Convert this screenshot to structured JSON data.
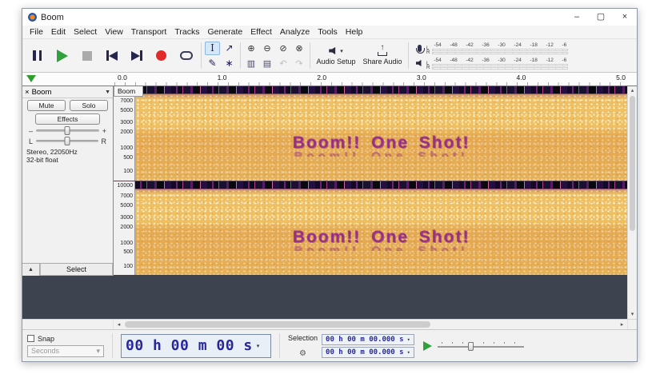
{
  "window": {
    "title": "Boom"
  },
  "window_controls": {
    "minimize": "–",
    "maximize": "▢",
    "close": "×"
  },
  "menu": {
    "items": [
      "File",
      "Edit",
      "Select",
      "View",
      "Transport",
      "Tracks",
      "Generate",
      "Effect",
      "Analyze",
      "Tools",
      "Help"
    ]
  },
  "toolbar": {
    "audio_setup_label": "Audio Setup",
    "share_audio_label": "Share Audio",
    "share_arrow": "↑",
    "dropdown_arrow": "▾",
    "meter_scale": [
      "-54",
      "-48",
      "-42",
      "-36",
      "-30",
      "-24",
      "-18",
      "-12",
      "-6"
    ],
    "meter_channels": [
      "L",
      "R"
    ],
    "tool_icons": {
      "selection": "I",
      "envelope": "↗",
      "draw": "✎",
      "multi": "∗"
    },
    "edit_icons": {
      "zoom_in": "⊕",
      "zoom_out": "⊖",
      "zoom_selection": "⊘",
      "zoom_toggle": "⊗",
      "trim": "▥",
      "silence": "▤",
      "undo": "↶",
      "redo": "↷"
    }
  },
  "timeline": {
    "ticks": [
      "0.0",
      "1.0",
      "2.0",
      "3.0",
      "4.0",
      "5.0"
    ]
  },
  "track": {
    "name": "Boom",
    "close_icon": "×",
    "menu_arrow": "▼",
    "mute_label": "Mute",
    "solo_label": "Solo",
    "effects_label": "Effects",
    "gain_minus": "–",
    "gain_plus": "+",
    "pan_left": "L",
    "pan_right": "R",
    "info_line1": "Stereo, 22050Hz",
    "info_line2": "32-bit float",
    "collapse_icon": "▲",
    "select_label": "Select",
    "freq_labels": [
      "10000",
      "7000",
      "5000",
      "3000",
      "2000",
      "1000",
      "500",
      "100"
    ],
    "spectrogram_text": "Boom!! One Shot!"
  },
  "scrollbars": {
    "up": "▴",
    "down": "▾",
    "left": "◂",
    "right": "▸"
  },
  "bottom": {
    "snap_label": "Snap",
    "snap_mode": "Seconds",
    "time_display": "00 h 00 m 00 s",
    "dropdown_arrow": "▾",
    "selection_label": "Selection",
    "settings_icon": "⚙",
    "selection_start": "00 h 00 m 00.000 s",
    "selection_end": "00 h 00 m 00.000 s"
  }
}
